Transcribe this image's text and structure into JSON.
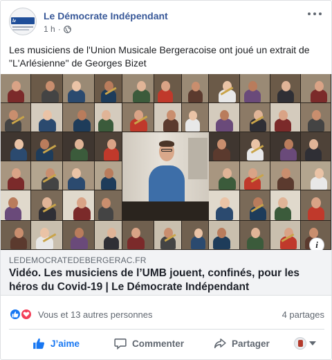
{
  "post": {
    "page_name": "Le Démocrate Indépendant",
    "avatar_logo_text": "le démocrate",
    "timestamp": "1 h",
    "separator": "·",
    "audience_icon": "globe-icon",
    "text": "Les musiciens de l'Union Musicale Bergeracoise ont joué un extrait de \"L'Arlésienne\" de Georges Bizet"
  },
  "link_preview": {
    "domain": "LEDEMOCRATEDEBERGERAC.FR",
    "title": "Vidéo. Les musiciens de l’UMB jouent, confinés, pour les héros du Covid-19 | Le Démocrate Indépendant",
    "info_label": "i"
  },
  "reactions": {
    "icons": [
      "like-icon",
      "love-icon"
    ],
    "summary": "Vous et 13 autres personnes",
    "shares": "4 partages"
  },
  "actions": {
    "like": "J’aime",
    "comment": "Commenter",
    "share": "Partager"
  },
  "colors": {
    "brand": "#385898",
    "like_blue": "#1877f2",
    "love_red": "#f33e58",
    "muted": "#606770"
  }
}
